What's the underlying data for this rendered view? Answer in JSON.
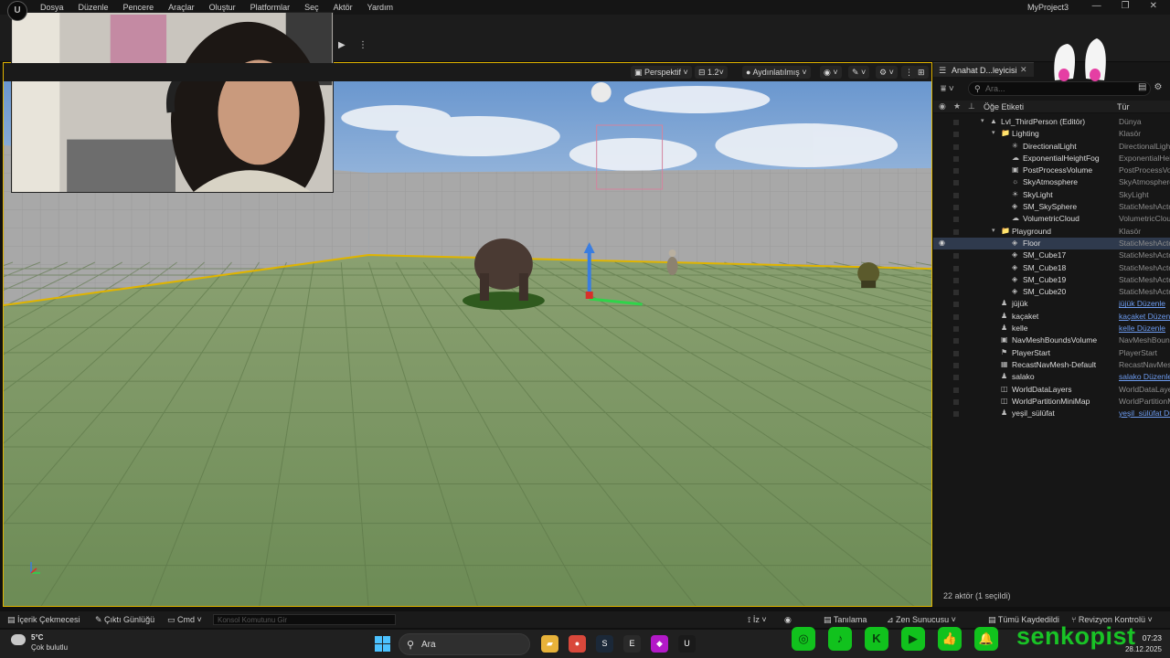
{
  "menubar": {
    "logo": "U",
    "items": [
      "Dosya",
      "Düzenle",
      "Pencere",
      "Araçlar",
      "Oluştur",
      "Platformlar",
      "Seç",
      "Aktör",
      "Yardım"
    ],
    "project_title": "MyProject3",
    "window_controls": [
      "—",
      "❐",
      "✕"
    ]
  },
  "toolbar": {
    "play_icon": "▶",
    "more_icon": "⋮"
  },
  "viewport": {
    "perspective_label": "Perspektif",
    "fov_label": "1.2",
    "lighting_label": "Aydınlatılmış",
    "view_icon": "◉",
    "snap_icon": "✎",
    "settings_icon": "⚙",
    "more_icon": "⋮",
    "layout_icon": "⊞",
    "selection_outline_color": "#e0b400"
  },
  "outliner": {
    "tab_title": "Anahat D...leyicisi",
    "tab_close": "✕",
    "search_placeholder": "Ara...",
    "col_label": "Öğe Etiketi",
    "col_type": "Tür",
    "rows": [
      {
        "name": "Lvl_ThirdPerson (Editör)",
        "type": "Dünya",
        "depth": 0,
        "icon": "▲",
        "link": false,
        "selected": false
      },
      {
        "name": "Lighting",
        "type": "Klasör",
        "depth": 1,
        "icon": "📁",
        "link": false,
        "selected": false
      },
      {
        "name": "DirectionalLight",
        "type": "DirectionalLight",
        "depth": 2,
        "icon": "✳",
        "link": false,
        "selected": false
      },
      {
        "name": "ExponentialHeightFog",
        "type": "ExponentialHeightFog",
        "depth": 2,
        "icon": "☁",
        "link": false,
        "selected": false
      },
      {
        "name": "PostProcessVolume",
        "type": "PostProcessVolume",
        "depth": 2,
        "icon": "▣",
        "link": false,
        "selected": false
      },
      {
        "name": "SkyAtmosphere",
        "type": "SkyAtmosphere",
        "depth": 2,
        "icon": "☼",
        "link": false,
        "selected": false
      },
      {
        "name": "SkyLight",
        "type": "SkyLight",
        "depth": 2,
        "icon": "☀",
        "link": false,
        "selected": false
      },
      {
        "name": "SM_SkySphere",
        "type": "StaticMeshActor",
        "depth": 2,
        "icon": "◈",
        "link": false,
        "selected": false
      },
      {
        "name": "VolumetricCloud",
        "type": "VolumetricCloud",
        "depth": 2,
        "icon": "☁",
        "link": false,
        "selected": false
      },
      {
        "name": "Playground",
        "type": "Klasör",
        "depth": 1,
        "icon": "📁",
        "link": false,
        "selected": false
      },
      {
        "name": "Floor",
        "type": "StaticMeshActor",
        "depth": 2,
        "icon": "◈",
        "link": false,
        "selected": true
      },
      {
        "name": "SM_Cube17",
        "type": "StaticMeshActor",
        "depth": 2,
        "icon": "◈",
        "link": false,
        "selected": false
      },
      {
        "name": "SM_Cube18",
        "type": "StaticMeshActor",
        "depth": 2,
        "icon": "◈",
        "link": false,
        "selected": false
      },
      {
        "name": "SM_Cube19",
        "type": "StaticMeshActor",
        "depth": 2,
        "icon": "◈",
        "link": false,
        "selected": false
      },
      {
        "name": "SM_Cube20",
        "type": "StaticMeshActor",
        "depth": 2,
        "icon": "◈",
        "link": false,
        "selected": false
      },
      {
        "name": "jüjük",
        "type": "jüjük Düzenle",
        "depth": 1,
        "icon": "♟",
        "link": true,
        "selected": false
      },
      {
        "name": "kaçaket",
        "type": "kaçaket Düzenle",
        "depth": 1,
        "icon": "♟",
        "link": true,
        "selected": false
      },
      {
        "name": "kelle",
        "type": "kelle Düzenle",
        "depth": 1,
        "icon": "♟",
        "link": true,
        "selected": false
      },
      {
        "name": "NavMeshBoundsVolume",
        "type": "NavMeshBoundsVolume",
        "depth": 1,
        "icon": "▣",
        "link": false,
        "selected": false
      },
      {
        "name": "PlayerStart",
        "type": "PlayerStart",
        "depth": 1,
        "icon": "⚑",
        "link": false,
        "selected": false
      },
      {
        "name": "RecastNavMesh-Default",
        "type": "RecastNavMesh",
        "depth": 1,
        "icon": "▦",
        "link": false,
        "selected": false
      },
      {
        "name": "salako",
        "type": "salako Düzenle",
        "depth": 1,
        "icon": "♟",
        "link": true,
        "selected": false
      },
      {
        "name": "WorldDataLayers",
        "type": "WorldDataLayers",
        "depth": 1,
        "icon": "◫",
        "link": false,
        "selected": false
      },
      {
        "name": "WorldPartitionMiniMap",
        "type": "WorldPartitionMiniMap",
        "depth": 1,
        "icon": "◫",
        "link": false,
        "selected": false
      },
      {
        "name": "yeşil_sülüfat",
        "type": "yeşil_sülüfat Düzenle",
        "depth": 1,
        "icon": "♟",
        "link": true,
        "selected": false
      }
    ],
    "footer": "22 aktör (1 seçildi)"
  },
  "statusbar": {
    "content_drawer": "İçerik Çekmecesi",
    "output_log": "Çıktı Günlüğü",
    "cmd": "Cmd",
    "console_placeholder": "Konsol Komutunu Gir",
    "trace": "İz",
    "diagnostics": "Tanılama",
    "zen_server": "Zen Sunucusu",
    "save_all": "Tümü Kaydedildi",
    "revision_control": "Revizyon Kontrolü"
  },
  "taskbar": {
    "weather_temp": "5°C",
    "weather_desc": "Çok bulutlu",
    "search_label": "Ara",
    "time": "07:23",
    "date": "28.12.2025",
    "apps": [
      {
        "icon": "folder-icon",
        "glyph": "▰",
        "color": "#e8b33a"
      },
      {
        "icon": "chrome-icon",
        "glyph": "●",
        "color": "#d9483b"
      },
      {
        "icon": "steam-icon",
        "glyph": "S",
        "color": "#1b2838"
      },
      {
        "icon": "epic-icon",
        "glyph": "E",
        "color": "#2a2a2a"
      },
      {
        "icon": "app-icon",
        "glyph": "◆",
        "color": "#b319c8"
      },
      {
        "icon": "unreal-icon",
        "glyph": "U",
        "color": "#1a1a1a"
      }
    ]
  },
  "overlay": {
    "social_handle": "senkopist",
    "social_icons": [
      "instagram-icon",
      "tiktok-icon",
      "kick-icon",
      "youtube-icon",
      "like-icon",
      "bell-icon"
    ],
    "social_glyphs": [
      "◎",
      "♪",
      "K",
      "▶",
      "👍",
      "🔔"
    ],
    "brand_color": "#19c326"
  }
}
